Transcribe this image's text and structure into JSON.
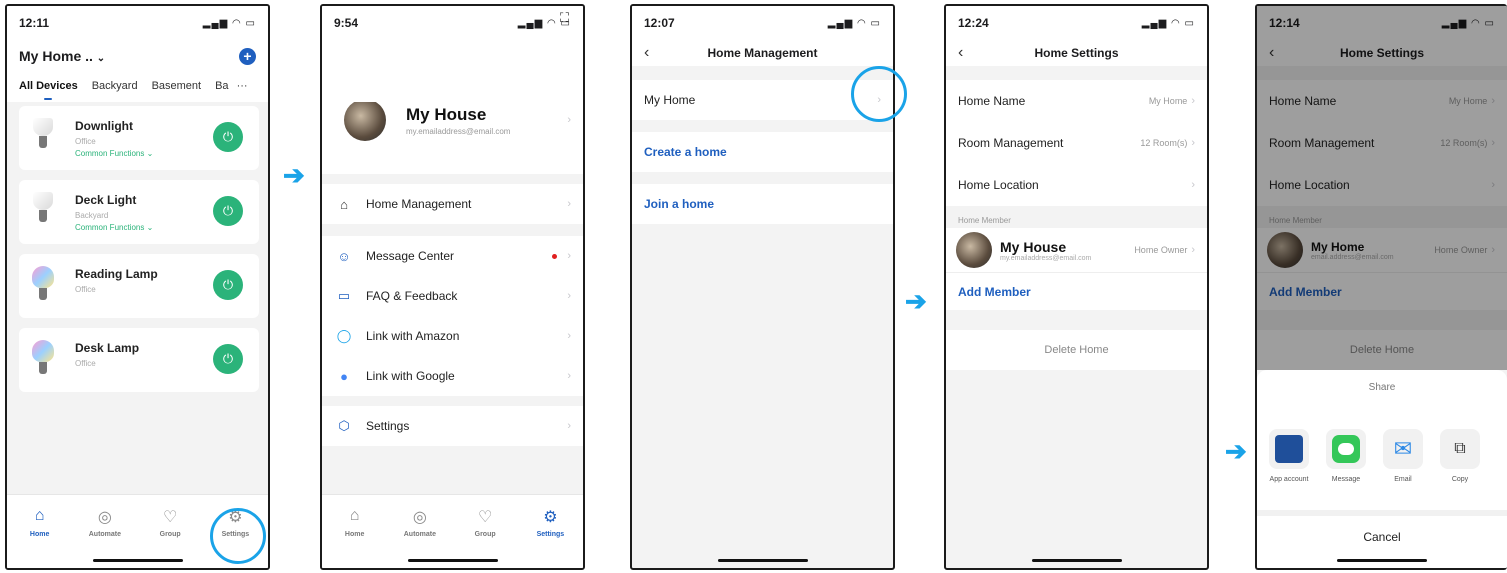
{
  "screen1": {
    "time": "12:11",
    "home_title": "My Home ..",
    "tabs": [
      "All Devices",
      "Backyard",
      "Basement",
      "Ba"
    ],
    "devices": [
      {
        "name": "Downlight",
        "room": "Office",
        "extra": "Common Functions"
      },
      {
        "name": "Deck Light",
        "room": "Backyard",
        "extra": "Common Functions"
      },
      {
        "name": "Reading Lamp",
        "room": "Office",
        "extra": ""
      },
      {
        "name": "Desk Lamp",
        "room": "Office",
        "extra": ""
      }
    ],
    "tabbar": [
      "Home",
      "Automate",
      "Group",
      "Settings"
    ]
  },
  "screen2": {
    "time": "9:54",
    "profile_name": "My House",
    "profile_email": "my.emailaddress@email.com",
    "menu": [
      "Home Management",
      "Message Center",
      "FAQ & Feedback",
      "Link with Amazon",
      "Link with Google",
      "Settings"
    ],
    "tabbar": [
      "Home",
      "Automate",
      "Group",
      "Settings"
    ]
  },
  "screen3": {
    "time": "12:07",
    "title": "Home Management",
    "items": [
      "My Home",
      "Create a home",
      "Join a home"
    ]
  },
  "screen4": {
    "time": "12:24",
    "title": "Home Settings",
    "rows": [
      {
        "label": "Home Name",
        "value": "My Home"
      },
      {
        "label": "Room Management",
        "value": "12 Room(s)"
      },
      {
        "label": "Home Location",
        "value": ""
      }
    ],
    "member_section": "Home Member",
    "member_name": "My House",
    "member_email": "my.emailaddress@email.com",
    "member_role": "Home Owner",
    "add_member": "Add Member",
    "delete_home": "Delete Home"
  },
  "screen5": {
    "time": "12:14",
    "title": "Home Settings",
    "rows": [
      {
        "label": "Home Name",
        "value": "My Home"
      },
      {
        "label": "Room Management",
        "value": "12 Room(s)"
      },
      {
        "label": "Home Location",
        "value": ""
      }
    ],
    "member_section": "Home Member",
    "member_name": "My Home",
    "member_email": "email.address@email.com",
    "member_role": "Home Owner",
    "add_member": "Add Member",
    "delete_home": "Delete Home",
    "share_title": "Share",
    "share_options": [
      "App account",
      "Message",
      "Email",
      "Copy"
    ],
    "cancel": "Cancel"
  },
  "colors": {
    "accent": "#1f5fbf",
    "highlight": "#1aa3e8",
    "power": "#2bb37a"
  }
}
